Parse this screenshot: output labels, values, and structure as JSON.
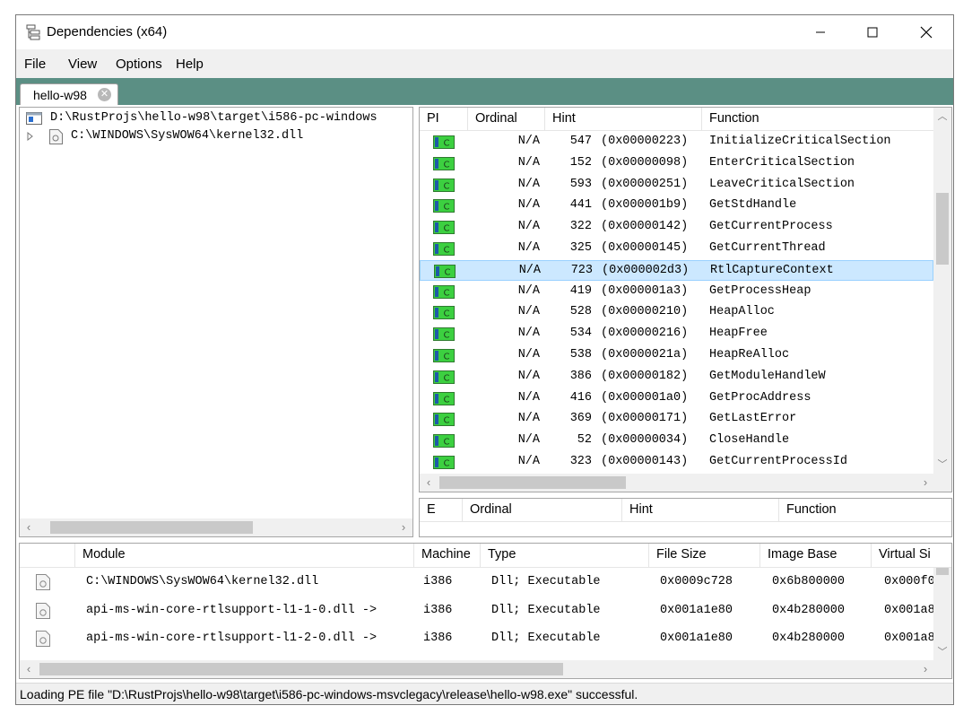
{
  "window": {
    "title": "Dependencies (x64)"
  },
  "menu": {
    "items": [
      "File",
      "View",
      "Options",
      "Help"
    ]
  },
  "tab": {
    "label": "hello-w98",
    "close_glyph": "✕"
  },
  "tree": {
    "items": [
      {
        "label": "D:\\RustProjs\\hello-w98\\target\\i586-pc-windows"
      },
      {
        "label": "C:\\WINDOWS\\SysWOW64\\kernel32.dll"
      }
    ]
  },
  "imports": {
    "headers": [
      "PI",
      "Ordinal",
      "Hint",
      "Function"
    ],
    "rows": [
      {
        "ordinal": "N/A",
        "hint": "547",
        "hex": "(0x00000223)",
        "function": "InitializeCriticalSection"
      },
      {
        "ordinal": "N/A",
        "hint": "152",
        "hex": "(0x00000098)",
        "function": "EnterCriticalSection"
      },
      {
        "ordinal": "N/A",
        "hint": "593",
        "hex": "(0x00000251)",
        "function": "LeaveCriticalSection"
      },
      {
        "ordinal": "N/A",
        "hint": "441",
        "hex": "(0x000001b9)",
        "function": "GetStdHandle"
      },
      {
        "ordinal": "N/A",
        "hint": "322",
        "hex": "(0x00000142)",
        "function": "GetCurrentProcess"
      },
      {
        "ordinal": "N/A",
        "hint": "325",
        "hex": "(0x00000145)",
        "function": "GetCurrentThread"
      },
      {
        "ordinal": "N/A",
        "hint": "723",
        "hex": "(0x000002d3)",
        "function": "RtlCaptureContext"
      },
      {
        "ordinal": "N/A",
        "hint": "419",
        "hex": "(0x000001a3)",
        "function": "GetProcessHeap"
      },
      {
        "ordinal": "N/A",
        "hint": "528",
        "hex": "(0x00000210)",
        "function": "HeapAlloc"
      },
      {
        "ordinal": "N/A",
        "hint": "534",
        "hex": "(0x00000216)",
        "function": "HeapFree"
      },
      {
        "ordinal": "N/A",
        "hint": "538",
        "hex": "(0x0000021a)",
        "function": "HeapReAlloc"
      },
      {
        "ordinal": "N/A",
        "hint": "386",
        "hex": "(0x00000182)",
        "function": "GetModuleHandleW"
      },
      {
        "ordinal": "N/A",
        "hint": "416",
        "hex": "(0x000001a0)",
        "function": "GetProcAddress"
      },
      {
        "ordinal": "N/A",
        "hint": "369",
        "hex": "(0x00000171)",
        "function": "GetLastError"
      },
      {
        "ordinal": "N/A",
        "hint": "52",
        "hex": "(0x00000034)",
        "function": "CloseHandle"
      },
      {
        "ordinal": "N/A",
        "hint": "323",
        "hex": "(0x00000143)",
        "function": "GetCurrentProcessId"
      }
    ],
    "selected_index": 6
  },
  "exports": {
    "headers": [
      "E",
      "Ordinal",
      "Hint",
      "Function"
    ]
  },
  "modules": {
    "headers": [
      "Module",
      "Machine",
      "Type",
      "File Size",
      "Image Base",
      "Virtual Si"
    ],
    "rows": [
      {
        "module": "C:\\WINDOWS\\SysWOW64\\kernel32.dll",
        "machine": "i386",
        "type": "Dll; Executable",
        "file_size": "0x0009c728",
        "image_base": "0x6b800000",
        "virtual": "0x000f0"
      },
      {
        "module": "api-ms-win-core-rtlsupport-l1-1-0.dll ->",
        "machine": "i386",
        "type": "Dll; Executable",
        "file_size": "0x001a1e80",
        "image_base": "0x4b280000",
        "virtual": "0x001a8"
      },
      {
        "module": "api-ms-win-core-rtlsupport-l1-2-0.dll ->",
        "machine": "i386",
        "type": "Dll; Executable",
        "file_size": "0x001a1e80",
        "image_base": "0x4b280000",
        "virtual": "0x001a8"
      }
    ]
  },
  "status": {
    "text": "Loading PE file \"D:\\RustProjs\\hello-w98\\target\\i586-pc-windows-msvclegacy\\release\\hello-w98.exe\" successful."
  },
  "colors": {
    "tabstrip": "#5b8f84",
    "selection": "#cce8ff",
    "import_icon_green": "#3cd040"
  }
}
